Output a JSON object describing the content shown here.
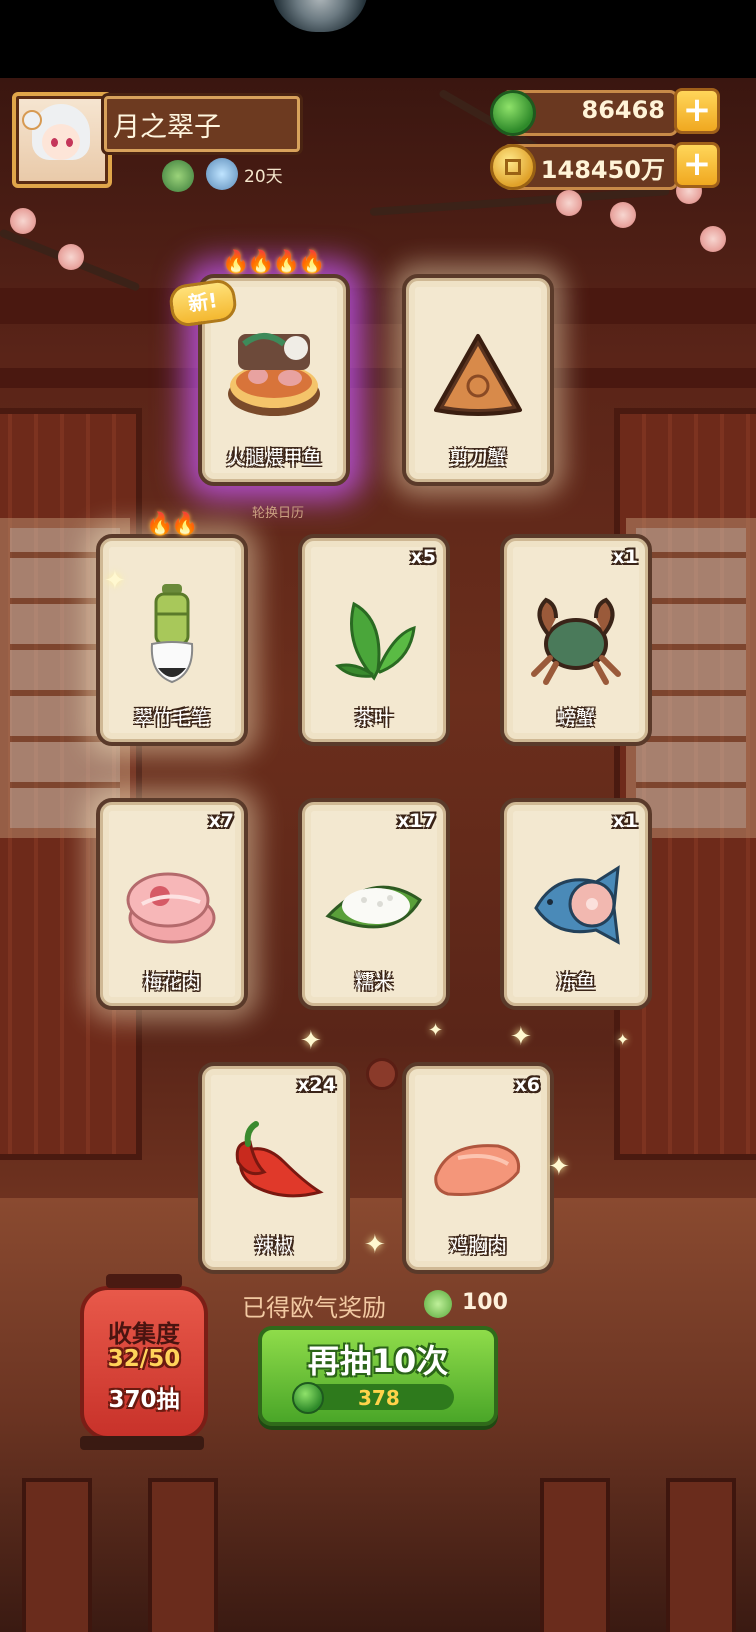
{
  "player": {
    "name": "月之翠子",
    "days": "20天"
  },
  "currency": {
    "jade": "86468",
    "coins": "148450万"
  },
  "calendar_caption": "轮换日历",
  "new_tag": "新!",
  "cards": [
    {
      "name": "火腿煨甲鱼",
      "count": "",
      "flames": 4,
      "highlight": "purple",
      "icon": "ham-turtle-dish-icon"
    },
    {
      "name": "剪刀蟹",
      "count": "",
      "flames": 0,
      "highlight": "glow",
      "icon": "triangle-cracker-icon"
    },
    {
      "name": "翠竹毛笔",
      "count": "",
      "flames": 2,
      "highlight": "glow",
      "icon": "bamboo-brush-icon"
    },
    {
      "name": "茶叶",
      "count": "x5",
      "flames": 0,
      "highlight": "none",
      "icon": "tea-leaf-icon"
    },
    {
      "name": "螃蟹",
      "count": "x1",
      "flames": 0,
      "highlight": "none",
      "icon": "crab-icon"
    },
    {
      "name": "梅花肉",
      "count": "x7",
      "flames": 0,
      "highlight": "glow",
      "icon": "pork-icon"
    },
    {
      "name": "糯米",
      "count": "x17",
      "flames": 0,
      "highlight": "none",
      "icon": "sticky-rice-icon"
    },
    {
      "name": "冻鱼",
      "count": "x1",
      "flames": 0,
      "highlight": "none",
      "icon": "frozen-fish-icon"
    },
    {
      "name": "辣椒",
      "count": "x24",
      "flames": 0,
      "highlight": "none",
      "icon": "chili-icon"
    },
    {
      "name": "鸡胸肉",
      "count": "x6",
      "flames": 0,
      "highlight": "none",
      "icon": "chicken-breast-icon"
    }
  ],
  "collection": {
    "title": "收集度",
    "progress": "32/50",
    "draws": "370抽"
  },
  "luck_reward": {
    "label": "已得欧气奖励",
    "value": "100"
  },
  "draw_button": {
    "label": "再抽10次",
    "cost": "378"
  },
  "colors": {
    "accent_gold": "#f0a820",
    "button_green": "#4aa628",
    "card_bg": "#f3e8d0",
    "rare_glow": "#c85aff"
  }
}
